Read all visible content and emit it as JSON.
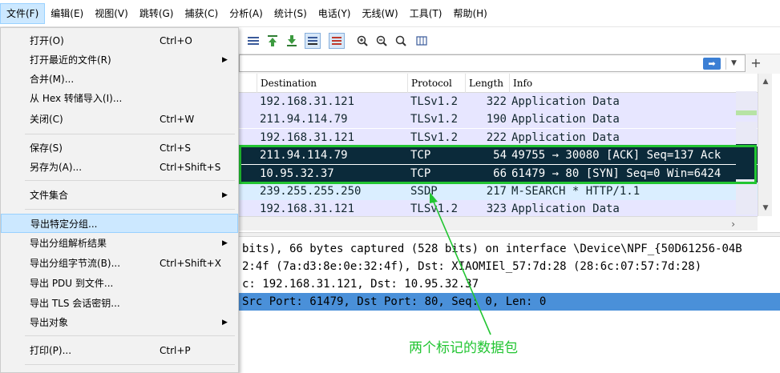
{
  "menubar": {
    "items": [
      "文件(F)",
      "编辑(E)",
      "视图(V)",
      "跳转(G)",
      "捕获(C)",
      "分析(A)",
      "统计(S)",
      "电话(Y)",
      "无线(W)",
      "工具(T)",
      "帮助(H)"
    ],
    "active_index": 0
  },
  "file_menu": {
    "items": [
      {
        "label": "打开(O)",
        "shortcut": "Ctrl+O",
        "submenu": false
      },
      {
        "label": "打开最近的文件(R)",
        "shortcut": "",
        "submenu": true
      },
      {
        "label": "合并(M)...",
        "shortcut": "",
        "submenu": false
      },
      {
        "label": "从 Hex 转储导入(I)...",
        "shortcut": "",
        "submenu": false
      },
      {
        "label": "关闭(C)",
        "shortcut": "Ctrl+W",
        "submenu": false
      },
      {
        "label": "保存(S)",
        "shortcut": "Ctrl+S",
        "submenu": false
      },
      {
        "label": "另存为(A)...",
        "shortcut": "Ctrl+Shift+S",
        "submenu": false
      },
      {
        "label": "文件集合",
        "shortcut": "",
        "submenu": true
      },
      {
        "label": "导出特定分组...",
        "shortcut": "",
        "submenu": false,
        "highlighted": true
      },
      {
        "label": "导出分组解析结果",
        "shortcut": "",
        "submenu": true
      },
      {
        "label": "导出分组字节流(B)...",
        "shortcut": "Ctrl+Shift+X",
        "submenu": false
      },
      {
        "label": "导出 PDU 到文件...",
        "shortcut": "",
        "submenu": false
      },
      {
        "label": "导出 TLS 会话密钥...",
        "shortcut": "",
        "submenu": false
      },
      {
        "label": "导出对象",
        "shortcut": "",
        "submenu": true
      },
      {
        "label": "打印(P)...",
        "shortcut": "Ctrl+P",
        "submenu": false
      }
    ]
  },
  "packet_list": {
    "columns": [
      "Destination",
      "Protocol",
      "Length",
      "Info"
    ],
    "rows": [
      {
        "destination": "192.168.31.121",
        "protocol": "TLSv1.2",
        "length": "322",
        "info": "Application Data",
        "bg": "#e7e6ff",
        "fg": "#12272e"
      },
      {
        "destination": "211.94.114.79",
        "protocol": "TLSv1.2",
        "length": "190",
        "info": "Application Data",
        "bg": "#e7e6ff",
        "fg": "#12272e"
      },
      {
        "destination": "192.168.31.121",
        "protocol": "TLSv1.2",
        "length": "222",
        "info": "Application Data",
        "bg": "#e7e6ff",
        "fg": "#12272e"
      },
      {
        "destination": "211.94.114.79",
        "protocol": "TCP",
        "length": "54",
        "info": "49755 → 30080 [ACK] Seq=137 Ack",
        "bg": "#0b2a3a",
        "fg": "#ffffff"
      },
      {
        "destination": "10.95.32.37",
        "protocol": "TCP",
        "length": "66",
        "info": "61479 → 80 [SYN] Seq=0 Win=6424",
        "bg": "#0b2a3a",
        "fg": "#ffffff"
      },
      {
        "destination": "239.255.255.250",
        "protocol": "SSDP",
        "length": "217",
        "info": "M-SEARCH * HTTP/1.1",
        "bg": "#daeeff",
        "fg": "#12272e"
      },
      {
        "destination": "192.168.31.121",
        "protocol": "TLSv1.2",
        "length": "323",
        "info": "Application Data",
        "bg": "#e7e6ff",
        "fg": "#12272e"
      }
    ]
  },
  "details": {
    "lines": [
      "bits), 66 bytes captured (528 bits) on interface \\Device\\NPF_{50D61256-04B",
      "2:4f (7a:d3:8e:0e:32:4f), Dst: XIAOMIEl_57:7d:28 (28:6c:07:57:7d:28)",
      "c: 192.168.31.121, Dst: 10.95.32.37",
      "Src Port: 61479, Dst Port: 80, Seq: 0, Len: 0"
    ],
    "selected_index": 3
  },
  "annotation": {
    "text": "两个标记的数据包",
    "color": "#22c532"
  }
}
